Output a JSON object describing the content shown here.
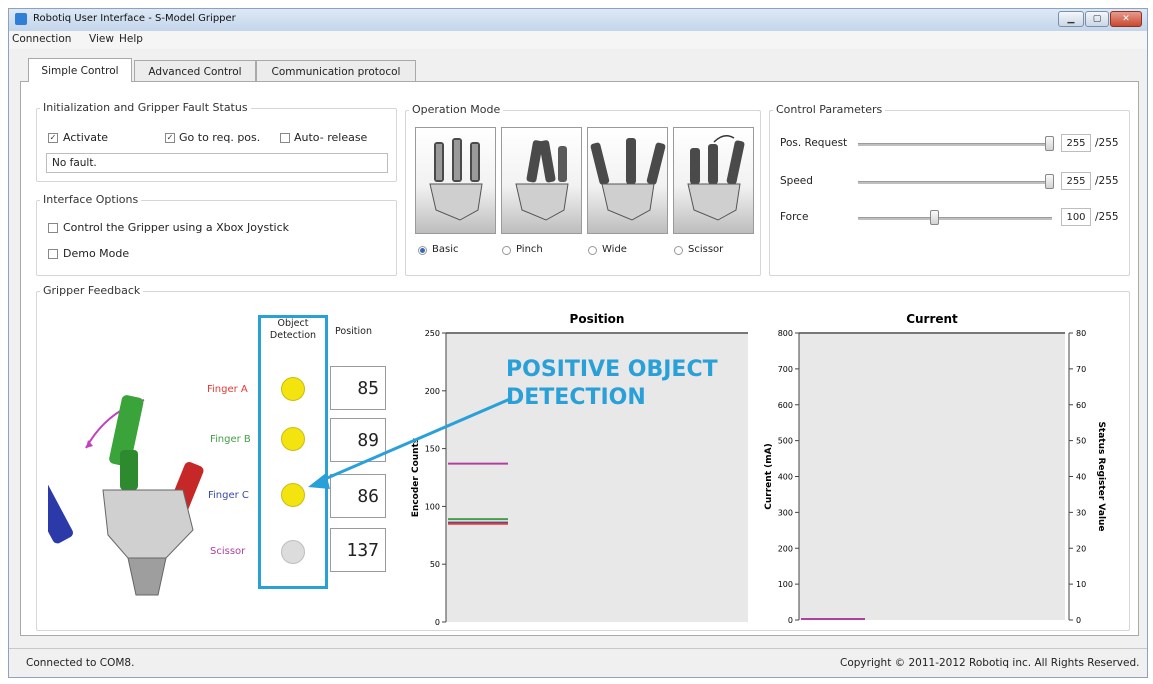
{
  "window": {
    "title": "Robotiq User Interface - S-Model Gripper",
    "minimize_glyph": "▁",
    "maximize_glyph": "▢",
    "close_glyph": "✕"
  },
  "menu": [
    "Connection",
    "View",
    "Help"
  ],
  "tabs": [
    "Simple Control",
    "Advanced Control",
    "Communication protocol"
  ],
  "init_group": {
    "title": "Initialization and Gripper Fault Status",
    "activate": {
      "label": "Activate",
      "checked": true
    },
    "go_to_req": {
      "label": "Go to req. pos.",
      "checked": true
    },
    "auto_release": {
      "label": "Auto- release",
      "checked": false
    },
    "fault_text": "No fault."
  },
  "interface_options": {
    "title": "Interface Options",
    "xbox": {
      "label": "Control the Gripper using a Xbox Joystick",
      "checked": false
    },
    "demo": {
      "label": "Demo Mode",
      "checked": false
    }
  },
  "operation_mode": {
    "title": "Operation Mode",
    "modes": [
      "Basic",
      "Pinch",
      "Wide",
      "Scissor"
    ],
    "selected": "Basic"
  },
  "control_params": {
    "title": "Control Parameters",
    "rows": [
      {
        "label": "Pos. Request",
        "value": "255",
        "max": "/255",
        "level": 1.0
      },
      {
        "label": "Speed",
        "value": "255",
        "max": "/255",
        "level": 1.0
      },
      {
        "label": "Force",
        "value": "100",
        "max": "/255",
        "level": 0.392
      }
    ]
  },
  "feedback": {
    "title": "Gripper Feedback",
    "col_object": "Object\nDetection",
    "col_position": "Position",
    "fingers": [
      {
        "label": "Finger A",
        "color": "#e53935",
        "detected": true,
        "position": "85"
      },
      {
        "label": "Finger B",
        "color": "#43a047",
        "detected": true,
        "position": "89"
      },
      {
        "label": "Finger C",
        "color": "#3949ab",
        "detected": true,
        "position": "86"
      },
      {
        "label": "Scissor",
        "color": "#b0409f",
        "detected": false,
        "position": "137"
      }
    ]
  },
  "annotation": {
    "line1": "POSITIVE OBJECT",
    "line2": "DETECTION",
    "color": "#2aa0d8"
  },
  "status": {
    "left": "Connected to COM8.",
    "right": "Copyright © 2011-2012 Robotiq inc. All Rights Reserved."
  },
  "chart_data": [
    {
      "type": "bar",
      "title": "Position",
      "ylabel": "Encoder Counts",
      "ylim": [
        0,
        250
      ],
      "yticks": [
        0,
        50,
        100,
        150,
        200,
        250
      ],
      "series": [
        {
          "color": "#b0409f",
          "values": [
            137
          ]
        },
        {
          "color": "#43a047",
          "values": [
            89
          ]
        },
        {
          "color": "#3949ab",
          "values": [
            86
          ]
        },
        {
          "color": "#e53935",
          "values": [
            85
          ]
        }
      ]
    },
    {
      "type": "bar",
      "title": "Current",
      "ylabel": "Current (mA)",
      "y2label": "Status Register Value",
      "ylim": [
        0,
        800
      ],
      "yticks": [
        0,
        100,
        200,
        300,
        400,
        500,
        600,
        700,
        800
      ],
      "y2lim": [
        0,
        80
      ],
      "y2ticks": [
        0,
        10,
        20,
        30,
        40,
        50,
        60,
        70,
        80
      ],
      "series": [
        {
          "color": "#b0409f",
          "values": [
            0
          ]
        }
      ]
    }
  ]
}
